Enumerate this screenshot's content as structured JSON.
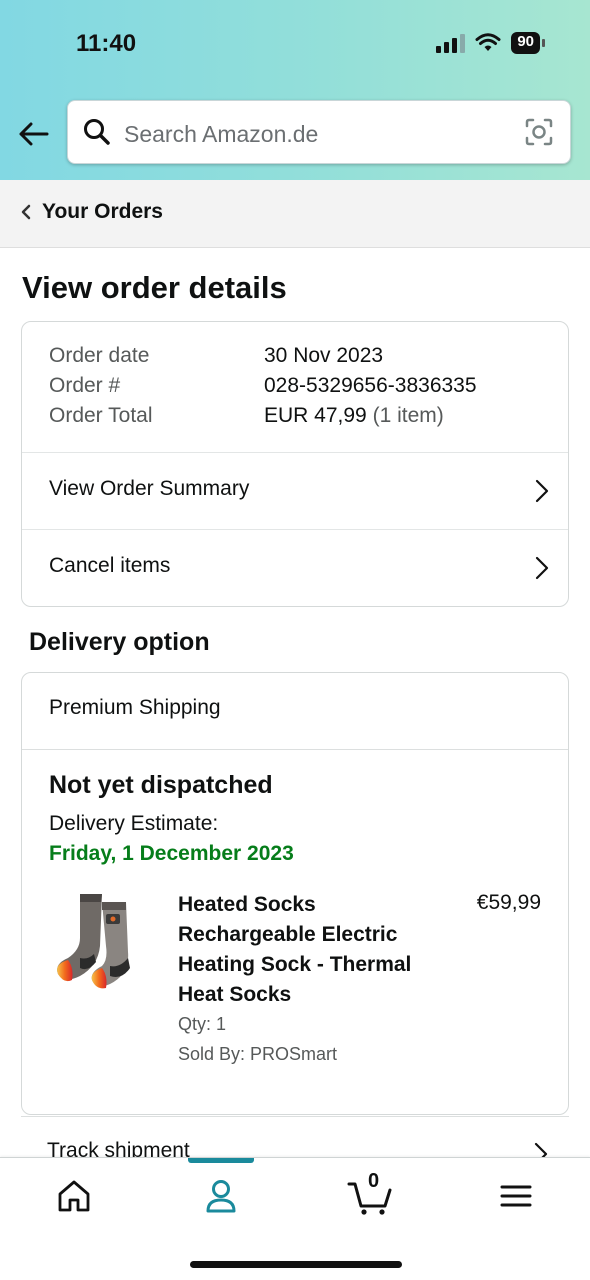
{
  "status_bar": {
    "time": "11:40",
    "battery": "90"
  },
  "search": {
    "placeholder": "Search Amazon.de"
  },
  "breadcrumb": {
    "label": "Your Orders"
  },
  "page": {
    "title": "View order details"
  },
  "order": {
    "rows": [
      {
        "label": "Order date",
        "value": "30 Nov 2023"
      },
      {
        "label": "Order #",
        "value": "028-5329656-3836335"
      },
      {
        "label": "Order Total",
        "value": "EUR 47,99",
        "extra": "(1 item)"
      }
    ],
    "links": {
      "summary": "View Order Summary",
      "cancel": "Cancel items"
    }
  },
  "delivery": {
    "section_title": "Delivery option",
    "method": "Premium Shipping",
    "status": "Not yet dispatched",
    "estimate_label": "Delivery Estimate:",
    "estimate_date": "Friday, 1 December 2023",
    "estimate_color": "#067d1a"
  },
  "product": {
    "title": "Heated Socks Rechargeable Electric Heating Sock - Thermal Heat Socks",
    "price": "€59,99",
    "qty": "Qty: 1",
    "seller": "Sold By: PROSmart"
  },
  "track": {
    "label": "Track shipment"
  },
  "nav": {
    "items": [
      "home-icon",
      "user-icon",
      "cart-icon",
      "menu-icon"
    ],
    "cart_count": "0",
    "active_color": "#1a8a9c"
  }
}
